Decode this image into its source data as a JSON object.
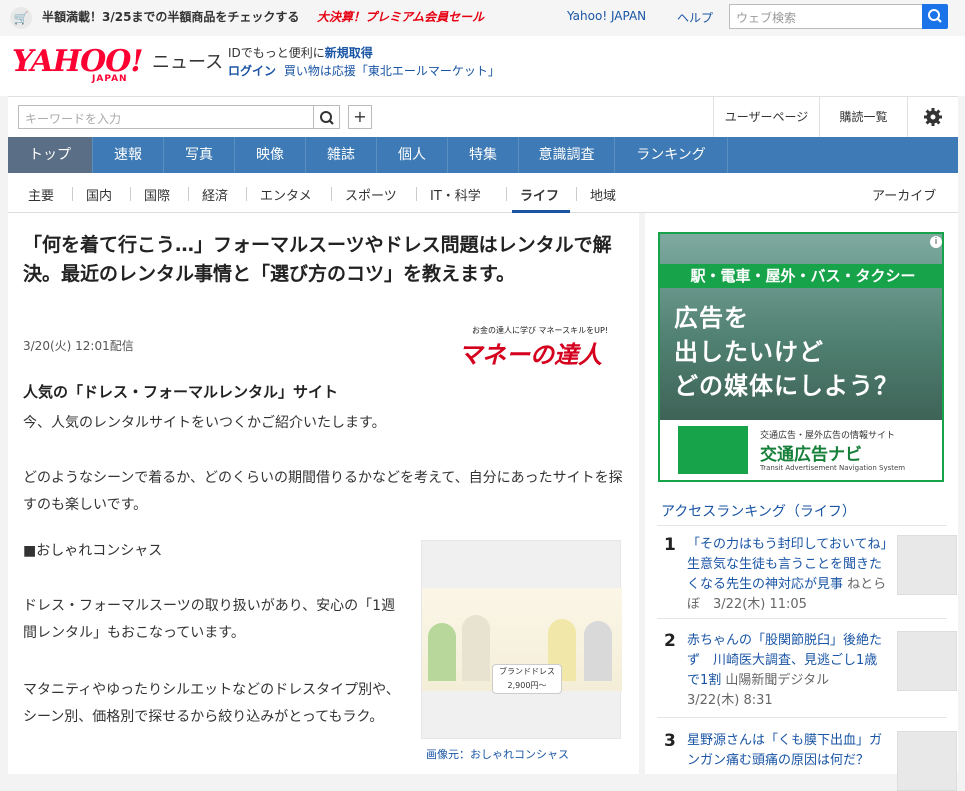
{
  "promo": {
    "text": "半額満載！3/25までの半額商品をチェックする",
    "sale": "大決算！プレミアム会員セール",
    "links": [
      "Yahoo! JAPAN",
      "ヘルプ"
    ],
    "search_placeholder": "ウェブ検索"
  },
  "header": {
    "logo": "YAHOO!",
    "logo_sub": "JAPAN",
    "service": "ニュース",
    "line1_prefix": "IDでもっと便利に",
    "line1_link": "新規取得",
    "line2_login": "ログイン",
    "line2_link": "買い物は応援「東北エールマーケット」"
  },
  "util": {
    "keyword_placeholder": "キーワードを入力",
    "plus": "+",
    "user_page": "ユーザーページ",
    "subscriptions": "購読一覧"
  },
  "nav": [
    "トップ",
    "速報",
    "写真",
    "映像",
    "雑誌",
    "個人",
    "特集",
    "意識調査",
    "ランキング"
  ],
  "subnav": {
    "items": [
      "主要",
      "国内",
      "国際",
      "経済",
      "エンタメ",
      "スポーツ",
      "IT・科学",
      "ライフ",
      "地域"
    ],
    "archive": "アーカイブ"
  },
  "article": {
    "title": "「何を着て行こう…」フォーマルスーツやドレス問題はレンタルで解決。最近のレンタル事情と「選び方のコツ」を教えます。",
    "date": "3/20(火) 12:01配信",
    "brand_small": "お金の達人に学び マネースキルをUP!",
    "brand_big": "マネーの達人",
    "heading": "人気の「ドレス・フォーマルレンタル」サイト",
    "p1": "今、人気のレンタルサイトをいつくかご紹介いたします。",
    "p2": "どのようなシーンで着るか、どのくらいの期間借りるかなどを考えて、自分にあったサイトを探すのも楽しいです。",
    "p3": "■おしゃれコンシャス",
    "p4": "ドレス・フォーマルスーツの取り扱いがあり、安心の「1週間レンタル」もおこなっています。",
    "p5": "マタニティやゆったりシルエットなどのドレスタイプ別や、シーン別、価格別で探せるから絞り込みがとってもラク。",
    "photo_badge": "ブランドドレス 2,900円〜",
    "photo_caption": "画像元：おしゃれコンシャス"
  },
  "ad": {
    "bar": "駅・電車・屋外・バス・タクシー",
    "line1": "広告を",
    "line2": "出したいけど",
    "line3": "どの媒体にしよう？",
    "foot_small": "交通広告・屋外広告の情報サイト",
    "foot_big": "交通広告ナビ",
    "foot_en": "Transit Advertisement Navigation System",
    "info": "i"
  },
  "ranking": {
    "title": "アクセスランキング（ライフ）",
    "items": [
      {
        "num": "1",
        "title": "「その力はもう封印しておいてね」　生意気な生徒も言うことを聞きたくなる先生の神対応が見事",
        "meta": "ねとらぼ　3/22(木) 11:05"
      },
      {
        "num": "2",
        "title": "赤ちゃんの「股関節脱臼」後絶たず　川崎医大調査、見逃ごし1歳で1割",
        "meta": "山陽新聞デジタル　3/22(木) 8:31"
      },
      {
        "num": "3",
        "title": "星野源さんは「くも膜下出血」ガンガン痛む頭痛の原因は何だ？",
        "meta": ""
      }
    ]
  }
}
